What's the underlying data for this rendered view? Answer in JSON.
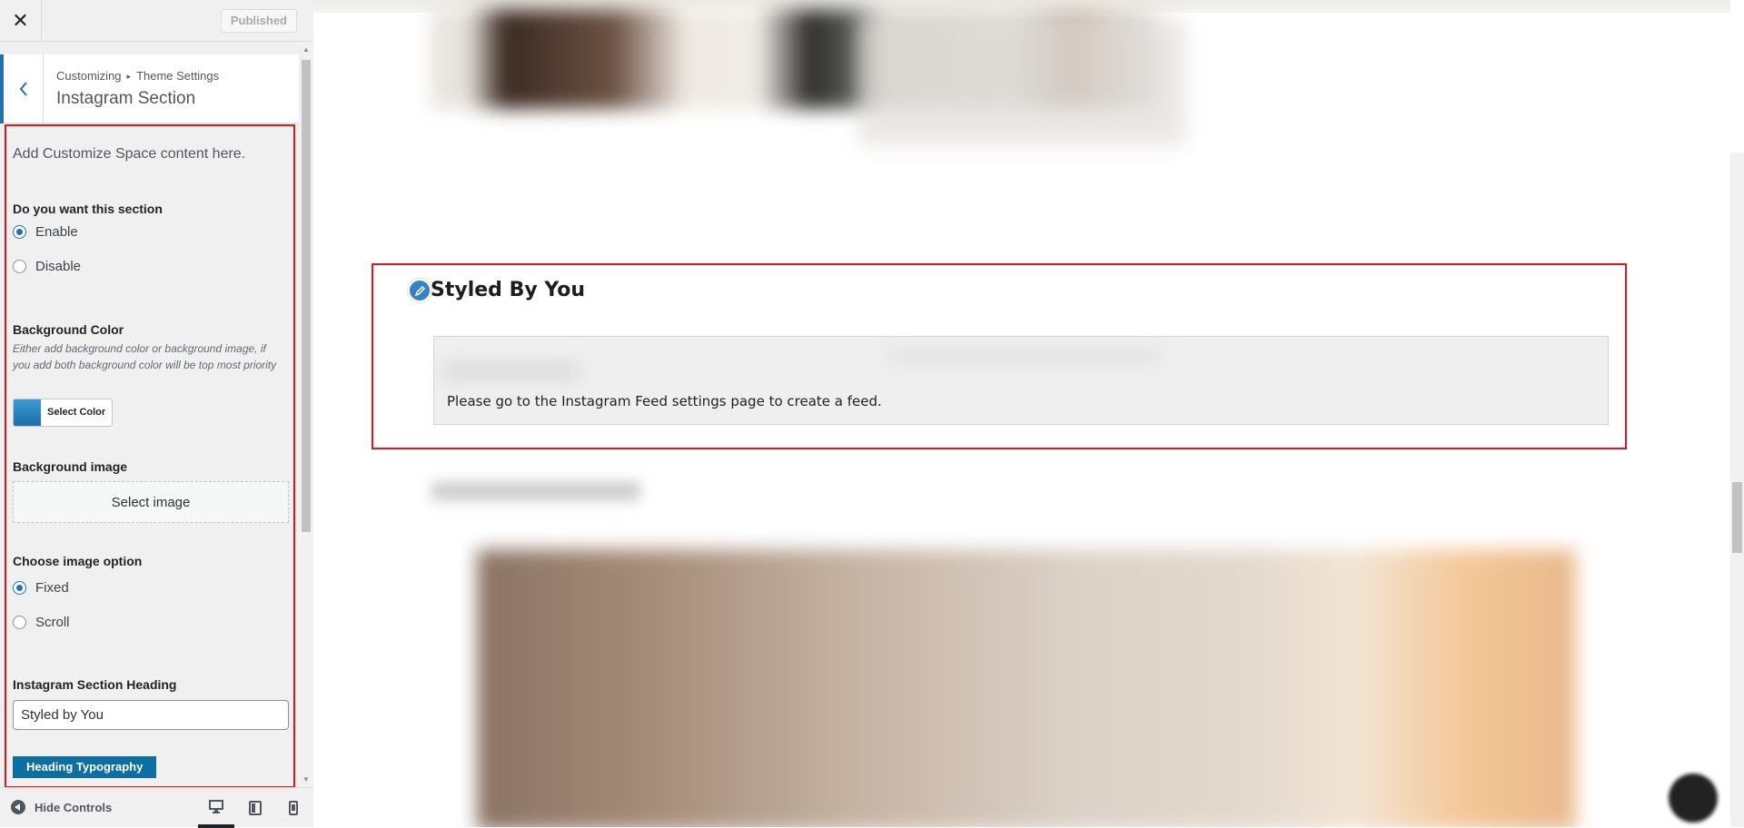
{
  "topbar": {
    "close_label": "✕",
    "publish_label": "Published"
  },
  "section_header": {
    "breadcrumb_root": "Customizing",
    "breadcrumb_separator": "▸",
    "breadcrumb_parent": "Theme Settings",
    "title": "Instagram Section"
  },
  "controls": {
    "description": "Add Customize Space content here.",
    "section_toggle": {
      "title": "Do you want this section",
      "options": [
        {
          "label": "Enable",
          "checked": true
        },
        {
          "label": "Disable",
          "checked": false
        }
      ]
    },
    "background_color": {
      "title": "Background Color",
      "help": "Either add background color or background image, if you add both background color will be top most priority",
      "button_label": "Select Color",
      "swatch_color": "#2a86c4"
    },
    "background_image": {
      "title": "Background image",
      "button_label": "Select image"
    },
    "image_option": {
      "title": "Choose image option",
      "options": [
        {
          "label": "Fixed",
          "checked": true
        },
        {
          "label": "Scroll",
          "checked": false
        }
      ]
    },
    "heading": {
      "title": "Instagram Section Heading",
      "value": "Styled by You"
    },
    "typography_button": "Heading Typography"
  },
  "footer": {
    "hide_controls_label": "Hide Controls"
  },
  "preview": {
    "section_heading": "Styled By You",
    "feed_message": "Please go to the Instagram Feed settings page to create a feed.",
    "annotation_color": "#e4141b"
  }
}
